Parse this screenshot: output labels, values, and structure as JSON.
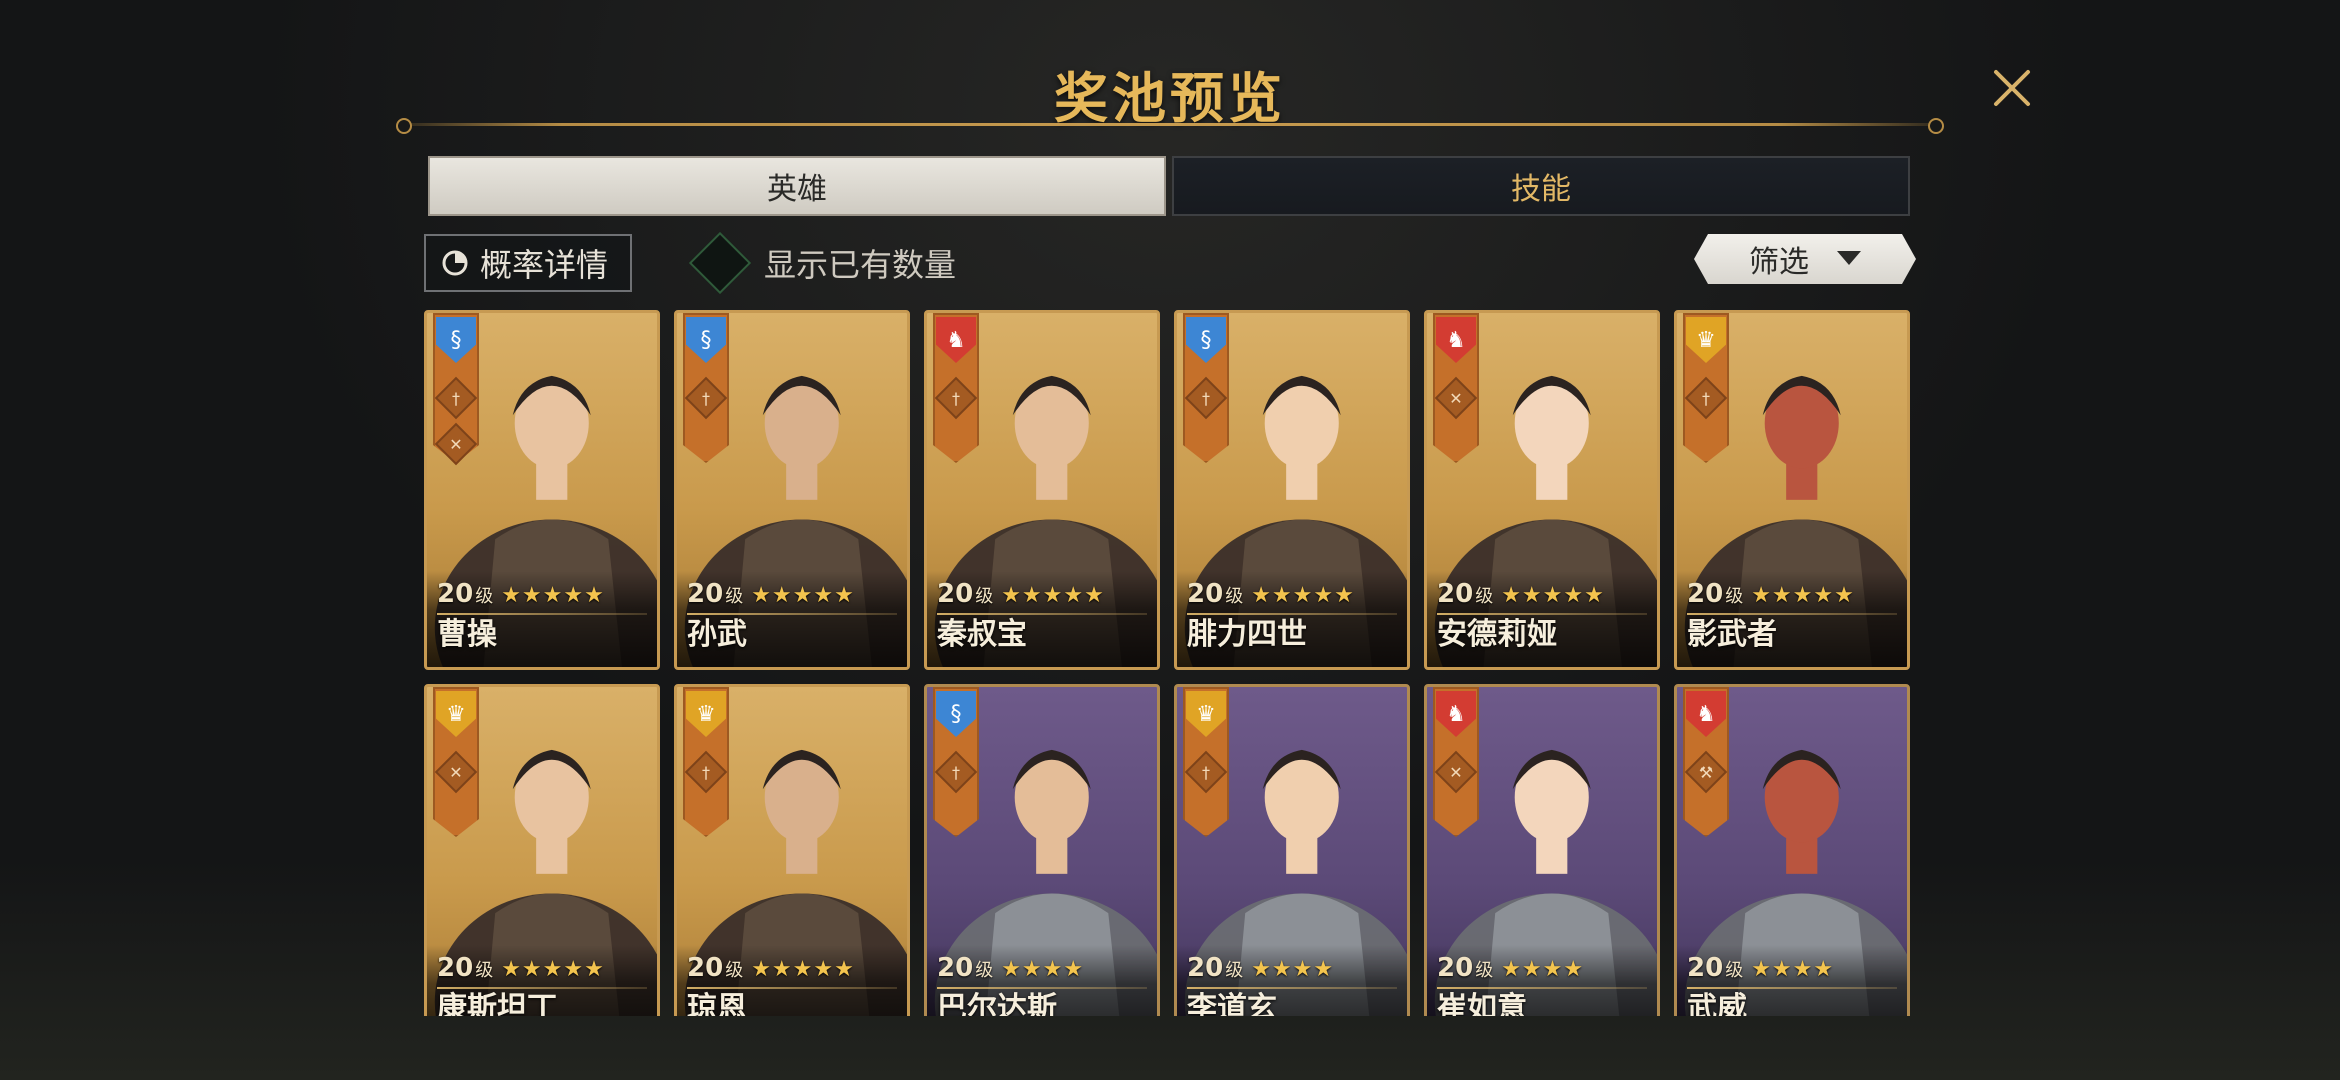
{
  "title": "奖池预览",
  "tabs": [
    {
      "label": "英雄",
      "active": true
    },
    {
      "label": "技能",
      "active": false
    }
  ],
  "controls": {
    "probability_label": "概率详情",
    "show_owned_label": "显示已有数量",
    "show_owned_checked": false,
    "filter_label": "筛选"
  },
  "colors": {
    "accent_gold": "#e6b85a",
    "card_gold": "#d9b068",
    "card_purple": "#6e5a8a",
    "star": "#f3c44e"
  },
  "heroes": [
    {
      "name": "曹操",
      "level": "20",
      "level_unit": "级",
      "stars": "★★★★★",
      "rarity": "gold",
      "faction": "blue",
      "classes": [
        "sword-icon",
        "axe-icon"
      ]
    },
    {
      "name": "孙武",
      "level": "20",
      "level_unit": "级",
      "stars": "★★★★★",
      "rarity": "gold",
      "faction": "blue",
      "classes": [
        "sword-icon"
      ]
    },
    {
      "name": "秦叔宝",
      "level": "20",
      "level_unit": "级",
      "stars": "★★★★★",
      "rarity": "gold",
      "faction": "red",
      "classes": [
        "sword-icon"
      ]
    },
    {
      "name": "腓力四世",
      "level": "20",
      "level_unit": "级",
      "stars": "★★★★★",
      "rarity": "gold",
      "faction": "blue",
      "classes": [
        "sword-icon"
      ]
    },
    {
      "name": "安德莉娅",
      "level": "20",
      "level_unit": "级",
      "stars": "★★★★★",
      "rarity": "gold",
      "faction": "red",
      "classes": [
        "axe-icon"
      ]
    },
    {
      "name": "影武者",
      "level": "20",
      "level_unit": "级",
      "stars": "★★★★★",
      "rarity": "gold",
      "faction": "yellow",
      "classes": [
        "sword-icon"
      ]
    },
    {
      "name": "康斯坦丁",
      "level": "20",
      "level_unit": "级",
      "stars": "★★★★★",
      "rarity": "gold",
      "faction": "yellow",
      "classes": [
        "axe-icon"
      ]
    },
    {
      "name": "琼恩",
      "level": "20",
      "level_unit": "级",
      "stars": "★★★★★",
      "rarity": "gold",
      "faction": "yellow",
      "classes": [
        "sword-icon"
      ]
    },
    {
      "name": "巴尔达斯",
      "level": "20",
      "level_unit": "级",
      "stars": "★★★★",
      "rarity": "purple",
      "faction": "blue",
      "classes": [
        "sword-icon"
      ]
    },
    {
      "name": "李道玄",
      "level": "20",
      "level_unit": "级",
      "stars": "★★★★",
      "rarity": "purple",
      "faction": "yellow",
      "classes": [
        "sword-icon"
      ]
    },
    {
      "name": "崔如意",
      "level": "20",
      "level_unit": "级",
      "stars": "★★★★",
      "rarity": "purple",
      "faction": "red",
      "classes": [
        "axe-icon"
      ]
    },
    {
      "name": "武威",
      "level": "20",
      "level_unit": "级",
      "stars": "★★★★",
      "rarity": "purple",
      "faction": "red",
      "classes": [
        "hammer-icon"
      ]
    }
  ]
}
